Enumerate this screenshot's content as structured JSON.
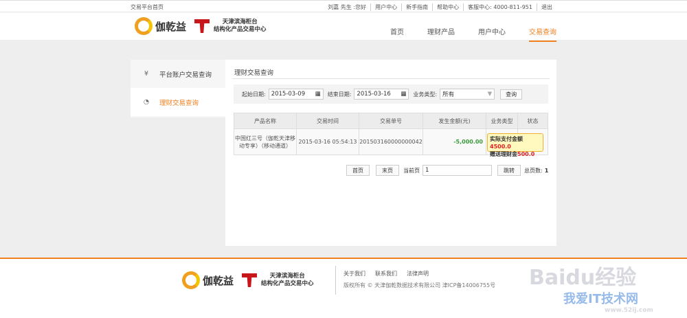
{
  "topbar": {
    "home": "交易平台首页",
    "greeting": "刘嘉  先生 :您好",
    "links": [
      "用户中心",
      "新手指南",
      "帮助中心",
      "客服中心: 4000-811-951",
      "退出"
    ]
  },
  "header": {
    "brand": "伽乾益",
    "partner_line1": "天津滨海柜台",
    "partner_line2": "结构化产品交易中心",
    "nav": [
      "首页",
      "理财产品",
      "用户中心",
      "交易查询"
    ]
  },
  "sidebar": {
    "items": [
      {
        "icon": "yen-icon",
        "label": "平台账户交易查询"
      },
      {
        "icon": "gauge-icon",
        "label": "理财交易查询"
      }
    ]
  },
  "main": {
    "title": "理财交易查询",
    "filter": {
      "start_label": "起始日期:",
      "start": "2015-03-09",
      "end_label": "结束日期:",
      "end": "2015-03-16",
      "type_label": "业务类型:",
      "type": "所有",
      "query": "查询"
    },
    "columns": [
      "产品名称",
      "交易时间",
      "交易单号",
      "发生金额(元)",
      "业务类型",
      "状态"
    ],
    "rows": [
      {
        "name": "中国红三号（伽乾天津移动专享）（移动通道）",
        "time": "2015-03-16 05:54:13",
        "no": "201503160000000042",
        "amount": "-5,000.00",
        "type": "",
        "status": ""
      }
    ],
    "tooltip": {
      "l1": "实际支付金额",
      "v1": "4500.0",
      "l2": "赠送理财金",
      "v2": "500.0"
    },
    "pager": {
      "first": "首页",
      "last": "末页",
      "current_label": "当前页",
      "current": "1",
      "go": "跳转",
      "total_label": "总页数:",
      "total": "1"
    }
  },
  "footer": {
    "links": [
      "关于我们",
      "联系我们",
      "法律声明"
    ],
    "copyright": "版权所有 © 天津伽乾数据技术有限公司 津ICP备14006755号"
  },
  "watermark": {
    "w1": "Baidu经验",
    "w2": "我爱IT技术网",
    "w3": "www.52ij.com"
  },
  "colors": {
    "accent": "#f08020",
    "amount": "#3a9a3a"
  }
}
